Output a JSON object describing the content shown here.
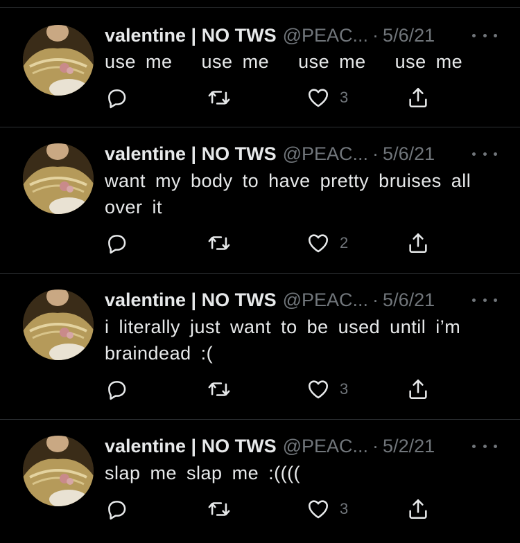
{
  "tweets": [
    {
      "name": "valentine | NO TWS",
      "handle": "@PEAC...",
      "separator": "·",
      "date": "5/6/21",
      "text": "use me   use me   use me   use me",
      "likes": "3"
    },
    {
      "name": "valentine | NO TWS",
      "handle": "@PEAC...",
      "separator": "·",
      "date": "5/6/21",
      "text": "want my body to have pretty bruises all over it",
      "likes": "2"
    },
    {
      "name": "valentine | NO TWS",
      "handle": "@PEAC...",
      "separator": "·",
      "date": "5/6/21",
      "text": "i literally just want to be used until i’m braindead :(",
      "likes": "3"
    },
    {
      "name": "valentine | NO TWS",
      "handle": "@PEAC...",
      "separator": "·",
      "date": "5/2/21",
      "text": "slap me slap me :((((",
      "likes": "3"
    }
  ],
  "icons": {
    "reply": "reply-icon",
    "retweet": "retweet-icon",
    "like": "heart-icon",
    "share": "share-icon",
    "more": "more-options-icon"
  },
  "colors": {
    "background": "#000000",
    "text": "#e7e9ea",
    "secondary": "#71767b",
    "divider": "#2f3336"
  }
}
